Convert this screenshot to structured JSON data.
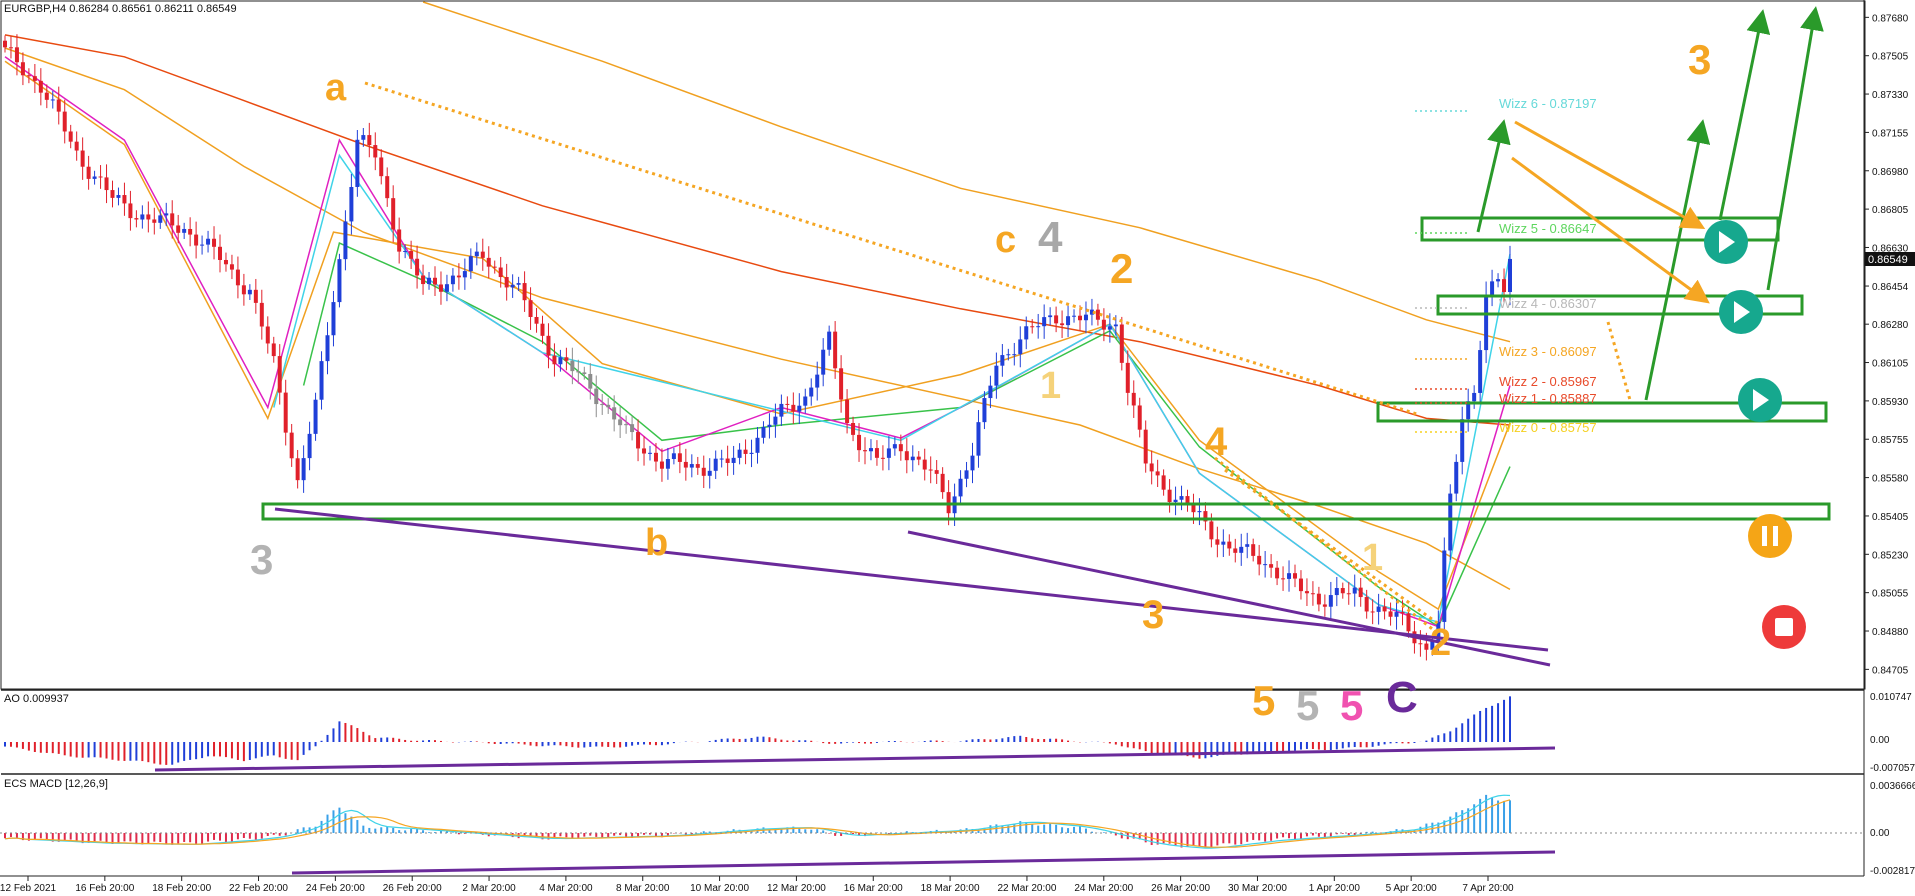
{
  "header": {
    "main_title": "EURGBP,H4  0.86284 0.86561 0.86211 0.86549",
    "ao_title": "AO 0.009937",
    "macd_title": "ECS MACD [12,26,9]"
  },
  "colors": {
    "bull": "#1f3fd8",
    "bear": "#e0202a",
    "neutral": "#8c8c8c",
    "green_box": "#2a9a2a",
    "purple": "#6a2a9a",
    "orange": "#f5a623",
    "ma_orange": "#f0a020",
    "ma_red": "#e84a10",
    "ma_green": "#39c24a",
    "ma_cyan": "#3fd3e8",
    "ma_magenta": "#e020c0",
    "teal_button": "#16a88e",
    "pause_button": "#f5a516",
    "stop_button": "#ee3a3a",
    "grey_label": "#b3b3b3"
  },
  "chart_data": [
    {
      "type": "candlestick",
      "title": "EURGBP,H4  0.86284 0.86561 0.86211 0.86549",
      "ylim": [
        0.8462,
        0.8775
      ],
      "price_ticks": [
        "0.87680",
        "0.87505",
        "0.87330",
        "0.87155",
        "0.86980",
        "0.86805",
        "0.86630",
        "0.86454",
        "0.86280",
        "0.86105",
        "0.85930",
        "0.85755",
        "0.85580",
        "0.85405",
        "0.85230",
        "0.85055",
        "0.84880",
        "0.84705"
      ],
      "price_tick_values": [
        0.8768,
        0.87505,
        0.8733,
        0.87155,
        0.8698,
        0.86805,
        0.8663,
        0.86454,
        0.8628,
        0.86105,
        0.8593,
        0.85755,
        0.8558,
        0.85405,
        0.8523,
        0.85055,
        0.8488,
        0.84705
      ],
      "current_price": "0.86549",
      "x_labels": [
        "12 Feb 2021",
        "16 Feb 20:00",
        "18 Feb 20:00",
        "22 Feb 20:00",
        "24 Feb 20:00",
        "26 Feb 20:00",
        "2 Mar 20:00",
        "4 Mar 20:00",
        "8 Mar 20:00",
        "10 Mar 20:00",
        "12 Mar 20:00",
        "16 Mar 20:00",
        "18 Mar 20:00",
        "22 Mar 20:00",
        "24 Mar 20:00",
        "26 Mar 20:00",
        "30 Mar 20:00",
        "1 Apr 20:00",
        "5 Apr 20:00",
        "7 Apr 20:00"
      ],
      "anchors": [
        [
          0,
          0.8752
        ],
        [
          6,
          0.8737
        ],
        [
          12,
          0.8706
        ],
        [
          18,
          0.8685
        ],
        [
          24,
          0.8676
        ],
        [
          30,
          0.8672
        ],
        [
          36,
          0.8658
        ],
        [
          41,
          0.8643
        ],
        [
          45,
          0.861
        ],
        [
          49,
          0.8556
        ],
        [
          52,
          0.859
        ],
        [
          56,
          0.8658
        ],
        [
          59,
          0.8712
        ],
        [
          62,
          0.8705
        ],
        [
          66,
          0.8665
        ],
        [
          70,
          0.8645
        ],
        [
          76,
          0.865
        ],
        [
          80,
          0.866
        ],
        [
          86,
          0.8642
        ],
        [
          92,
          0.8613
        ],
        [
          98,
          0.86
        ],
        [
          104,
          0.8578
        ],
        [
          110,
          0.8565
        ],
        [
          116,
          0.8563
        ],
        [
          122,
          0.8565
        ],
        [
          128,
          0.8583
        ],
        [
          134,
          0.8595
        ],
        [
          138,
          0.862
        ],
        [
          141,
          0.8582
        ],
        [
          146,
          0.8565
        ],
        [
          150,
          0.8573
        ],
        [
          155,
          0.856
        ],
        [
          158,
          0.8545
        ],
        [
          162,
          0.857
        ],
        [
          166,
          0.861
        ],
        [
          170,
          0.8622
        ],
        [
          176,
          0.8632
        ],
        [
          182,
          0.863
        ],
        [
          186,
          0.8628
        ],
        [
          188,
          0.8598
        ],
        [
          191,
          0.8565
        ],
        [
          196,
          0.8548
        ],
        [
          200,
          0.854
        ],
        [
          205,
          0.8525
        ],
        [
          210,
          0.8522
        ],
        [
          215,
          0.851
        ],
        [
          220,
          0.8503
        ],
        [
          226,
          0.8505
        ],
        [
          230,
          0.8498
        ],
        [
          234,
          0.8492
        ],
        [
          238,
          0.848
        ],
        [
          240,
          0.8492
        ],
        [
          242,
          0.8548
        ],
        [
          244,
          0.8585
        ],
        [
          246,
          0.86
        ],
        [
          248,
          0.864
        ],
        [
          250,
          0.8648
        ],
        [
          251,
          0.8642
        ],
        [
          252,
          0.8655
        ]
      ],
      "moving_averages": [
        {
          "color": "ma_orange",
          "points": [
            [
              0,
              0.8754
            ],
            [
              20,
              0.8735
            ],
            [
              40,
              0.87
            ],
            [
              60,
              0.867
            ],
            [
              90,
              0.864
            ],
            [
              130,
              0.8612
            ],
            [
              180,
              0.8582
            ],
            [
              200,
              0.8562
            ],
            [
              220,
              0.8545
            ],
            [
              238,
              0.8528
            ],
            [
              252,
              0.8507
            ]
          ]
        },
        {
          "color": "ma_red",
          "points": [
            [
              0,
              0.876
            ],
            [
              20,
              0.875
            ],
            [
              40,
              0.873
            ],
            [
              60,
              0.871
            ],
            [
              90,
              0.8682
            ],
            [
              130,
              0.8652
            ],
            [
              160,
              0.8635
            ],
            [
              190,
              0.862
            ],
            [
              220,
              0.86
            ],
            [
              238,
              0.8585
            ],
            [
              252,
              0.8582
            ]
          ]
        },
        {
          "color": "ma_orange",
          "points": [
            [
              70,
              0.8775
            ],
            [
              100,
              0.8748
            ],
            [
              130,
              0.8718
            ],
            [
              160,
              0.869
            ],
            [
              190,
              0.8672
            ],
            [
              220,
              0.8648
            ],
            [
              238,
              0.863
            ],
            [
              252,
              0.862
            ]
          ]
        },
        {
          "color": "ma_orange",
          "points": [
            [
              0,
              0.8748
            ],
            [
              20,
              0.871
            ],
            [
              44,
              0.8585
            ],
            [
              55,
              0.867
            ],
            [
              80,
              0.8658
            ],
            [
              100,
              0.861
            ],
            [
              130,
              0.8587
            ],
            [
              160,
              0.8605
            ],
            [
              185,
              0.8628
            ],
            [
              200,
              0.8575
            ],
            [
              230,
              0.8515
            ],
            [
              240,
              0.8498
            ],
            [
              252,
              0.8583
            ]
          ]
        },
        {
          "color": "ma_green",
          "points": [
            [
              50,
              0.86
            ],
            [
              56,
              0.8665
            ],
            [
              70,
              0.8648
            ],
            [
              90,
              0.862
            ],
            [
              110,
              0.8575
            ],
            [
              130,
              0.8582
            ],
            [
              160,
              0.859
            ],
            [
              185,
              0.8625
            ],
            [
              200,
              0.8572
            ],
            [
              230,
              0.8508
            ],
            [
              240,
              0.849
            ],
            [
              252,
              0.8563
            ]
          ]
        },
        {
          "color": "ma_magenta",
          "points": [
            [
              0,
              0.875
            ],
            [
              20,
              0.8712
            ],
            [
              44,
              0.859
            ],
            [
              56,
              0.8712
            ],
            [
              70,
              0.865
            ],
            [
              90,
              0.8615
            ],
            [
              110,
              0.857
            ],
            [
              130,
              0.859
            ],
            [
              150,
              0.8576
            ],
            [
              160,
              0.859
            ],
            [
              185,
              0.8628
            ],
            [
              200,
              0.856
            ],
            [
              230,
              0.85
            ],
            [
              240,
              0.849
            ],
            [
              252,
              0.86
            ]
          ]
        },
        {
          "color": "ma_cyan",
          "points": [
            [
              45,
              0.859
            ],
            [
              56,
              0.8705
            ],
            [
              70,
              0.865
            ],
            [
              90,
              0.8615
            ],
            [
              150,
              0.8575
            ],
            [
              185,
              0.8628
            ],
            [
              200,
              0.856
            ],
            [
              230,
              0.85
            ],
            [
              240,
              0.8492
            ],
            [
              252,
              0.866
            ]
          ]
        }
      ],
      "wizz_levels": [
        {
          "label": "Wizz 6 - 0.87197",
          "price": 0.87197,
          "color": "#66d9d9"
        },
        {
          "label": "Wizz 5 - 0.86647",
          "price": 0.86647,
          "color": "#5ed65e"
        },
        {
          "label": "Wizz 4 - 0.86307",
          "price": 0.86307,
          "color": "#b8b8b8"
        },
        {
          "label": "Wizz 3 - 0.86097",
          "price": 0.86097,
          "color": "#f5a623"
        },
        {
          "label": "Wizz 2 - 0.85967",
          "price": 0.85967,
          "color": "#e84a2a"
        },
        {
          "label": "Wizz 1 - 0.85887",
          "price": 0.85887,
          "color": "#e84a2a"
        },
        {
          "label": "Wizz 0 - 0.85757",
          "price": 0.85757,
          "color": "#f5d020"
        }
      ]
    },
    {
      "type": "bar",
      "title": "AO 0.009937",
      "y_ticks": [
        "0.010747",
        "0.00",
        "-0.007057"
      ],
      "ylim": [
        -0.007057,
        0.010747
      ],
      "anchors": [
        [
          0,
          -0.001
        ],
        [
          10,
          -0.003
        ],
        [
          20,
          -0.004
        ],
        [
          28,
          -0.005
        ],
        [
          34,
          -0.003
        ],
        [
          40,
          -0.004
        ],
        [
          45,
          -0.003
        ],
        [
          49,
          -0.004
        ],
        [
          52,
          -0.001
        ],
        [
          56,
          0.0045
        ],
        [
          59,
          0.003
        ],
        [
          62,
          0.001
        ],
        [
          70,
          0.0003
        ],
        [
          80,
          -0.0001
        ],
        [
          90,
          -0.0008
        ],
        [
          100,
          -0.0012
        ],
        [
          110,
          -0.0005
        ],
        [
          120,
          0.0005
        ],
        [
          126,
          0.0011
        ],
        [
          134,
          0.0002
        ],
        [
          140,
          -0.0004
        ],
        [
          150,
          0.0001
        ],
        [
          160,
          0.0002
        ],
        [
          170,
          0.0012
        ],
        [
          178,
          0.0003
        ],
        [
          186,
          -0.0004
        ],
        [
          192,
          -0.0025
        ],
        [
          200,
          -0.0035
        ],
        [
          208,
          -0.0025
        ],
        [
          216,
          -0.0018
        ],
        [
          224,
          -0.0015
        ],
        [
          232,
          -0.0005
        ],
        [
          238,
          0.0002
        ],
        [
          242,
          0.0025
        ],
        [
          248,
          0.0075
        ],
        [
          252,
          0.0099
        ]
      ]
    },
    {
      "type": "bar",
      "title": "ECS MACD [12,26,9]",
      "y_ticks": [
        "0.0036666",
        "0.00",
        "-0.0028175"
      ],
      "ylim": [
        -0.0028175,
        0.0036666
      ],
      "anchors": [
        [
          0,
          -0.0004
        ],
        [
          15,
          -0.0007
        ],
        [
          30,
          -0.0008
        ],
        [
          40,
          -0.0005
        ],
        [
          46,
          -0.0002
        ],
        [
          52,
          0.0006
        ],
        [
          56,
          0.002
        ],
        [
          60,
          0.0005
        ],
        [
          70,
          0.0002
        ],
        [
          90,
          -0.0004
        ],
        [
          110,
          -0.0002
        ],
        [
          126,
          0.0003
        ],
        [
          134,
          0.0004
        ],
        [
          140,
          -0.0002
        ],
        [
          160,
          0.0002
        ],
        [
          170,
          0.0008
        ],
        [
          180,
          0.0004
        ],
        [
          186,
          -0.0002
        ],
        [
          192,
          -0.0008
        ],
        [
          200,
          -0.0011
        ],
        [
          212,
          -0.0005
        ],
        [
          226,
          -0.0001
        ],
        [
          236,
          0.0003
        ],
        [
          242,
          0.0012
        ],
        [
          248,
          0.0028
        ],
        [
          252,
          0.0024
        ]
      ]
    }
  ],
  "wave_labels": [
    {
      "text": "a",
      "color": "#f5a623",
      "size": 38
    },
    {
      "text": "b",
      "color": "#f5a623",
      "size": 38
    },
    {
      "text": "c",
      "color": "#f5a623",
      "size": 38
    },
    {
      "text": "4",
      "color": "#a8a8a8",
      "size": 44
    },
    {
      "text": "2",
      "color": "#f5a623",
      "size": 42
    },
    {
      "text": "1",
      "color": "#f5d27a",
      "size": 38
    },
    {
      "text": "3",
      "color": "#b3b3b3",
      "size": 42
    },
    {
      "text": "4",
      "color": "#f5a623",
      "size": 40
    },
    {
      "text": "3",
      "color": "#f5a623",
      "size": 40
    },
    {
      "text": "1",
      "color": "#f5d27a",
      "size": 38
    },
    {
      "text": "2",
      "color": "#f5a623",
      "size": 38
    },
    {
      "text": "5",
      "color": "#f5a623",
      "size": 42
    },
    {
      "text": "5",
      "color": "#b3b3b3",
      "size": 42
    },
    {
      "text": "5",
      "color": "#f052b0",
      "size": 42
    },
    {
      "text": "C",
      "color": "#6a2a9a",
      "size": 44
    },
    {
      "text": "3",
      "color": "#f5a623",
      "size": 42
    }
  ]
}
